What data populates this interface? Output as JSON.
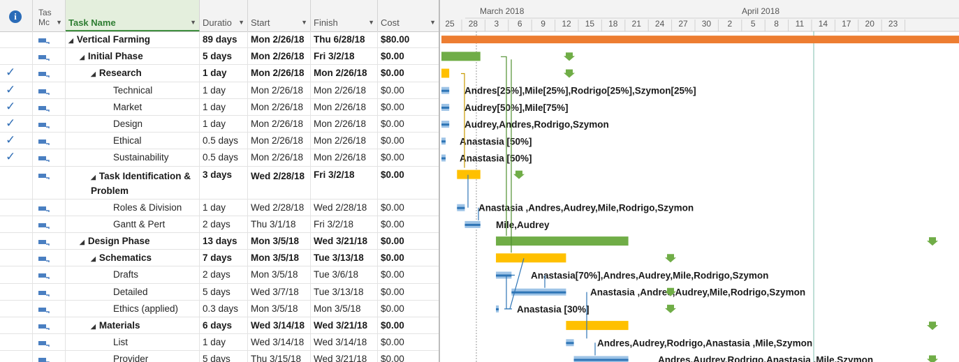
{
  "table": {
    "headers": {
      "mode_line1": "Tas",
      "mode_line2": "Mc",
      "task_name": "Task Name",
      "duration": "Duratio",
      "start": "Start",
      "finish": "Finish",
      "cost": "Cost"
    },
    "rows": [
      {
        "done": false,
        "level": 0,
        "summary": true,
        "name": "Vertical Farming",
        "duration": "89 days",
        "start": "Mon 2/26/18",
        "finish": "Thu 6/28/18",
        "cost": "$80.00"
      },
      {
        "done": false,
        "level": 1,
        "summary": true,
        "name": "Initial Phase",
        "duration": "5 days",
        "start": "Mon 2/26/18",
        "finish": "Fri 3/2/18",
        "cost": "$0.00"
      },
      {
        "done": true,
        "level": 2,
        "summary": true,
        "name": "Research",
        "duration": "1 day",
        "start": "Mon 2/26/18",
        "finish": "Mon 2/26/18",
        "cost": "$0.00"
      },
      {
        "done": true,
        "level": 3,
        "summary": false,
        "name": "Technical",
        "duration": "1 day",
        "start": "Mon 2/26/18",
        "finish": "Mon 2/26/18",
        "cost": "$0.00"
      },
      {
        "done": true,
        "level": 3,
        "summary": false,
        "name": "Market",
        "duration": "1 day",
        "start": "Mon 2/26/18",
        "finish": "Mon 2/26/18",
        "cost": "$0.00"
      },
      {
        "done": true,
        "level": 3,
        "summary": false,
        "name": "Design",
        "duration": "1 day",
        "start": "Mon 2/26/18",
        "finish": "Mon 2/26/18",
        "cost": "$0.00"
      },
      {
        "done": true,
        "level": 3,
        "summary": false,
        "name": "Ethical",
        "duration": "0.5 days",
        "start": "Mon 2/26/18",
        "finish": "Mon 2/26/18",
        "cost": "$0.00"
      },
      {
        "done": true,
        "level": 3,
        "summary": false,
        "name": "Sustainability",
        "duration": "0.5 days",
        "start": "Mon 2/26/18",
        "finish": "Mon 2/26/18",
        "cost": "$0.00"
      },
      {
        "done": false,
        "level": 2,
        "summary": true,
        "name": "Task Identification & Problem",
        "duration": "3 days",
        "start": "Wed 2/28/18",
        "finish": "Fri 3/2/18",
        "cost": "$0.00"
      },
      {
        "done": false,
        "level": 3,
        "summary": false,
        "name": "Roles & Division",
        "duration": "1 day",
        "start": "Wed 2/28/18",
        "finish": "Wed 2/28/18",
        "cost": "$0.00"
      },
      {
        "done": false,
        "level": 3,
        "summary": false,
        "name": "Gantt & Pert",
        "duration": "2 days",
        "start": "Thu 3/1/18",
        "finish": "Fri 3/2/18",
        "cost": "$0.00"
      },
      {
        "done": false,
        "level": 1,
        "summary": true,
        "name": "Design Phase",
        "duration": "13 days",
        "start": "Mon 3/5/18",
        "finish": "Wed 3/21/18",
        "cost": "$0.00"
      },
      {
        "done": false,
        "level": 2,
        "summary": true,
        "name": "Schematics",
        "duration": "7 days",
        "start": "Mon 3/5/18",
        "finish": "Tue 3/13/18",
        "cost": "$0.00"
      },
      {
        "done": false,
        "level": 3,
        "summary": false,
        "name": "Drafts",
        "duration": "2 days",
        "start": "Mon 3/5/18",
        "finish": "Tue 3/6/18",
        "cost": "$0.00"
      },
      {
        "done": false,
        "level": 3,
        "summary": false,
        "name": "Detailed",
        "duration": "5 days",
        "start": "Wed 3/7/18",
        "finish": "Tue 3/13/18",
        "cost": "$0.00"
      },
      {
        "done": false,
        "level": 3,
        "summary": false,
        "name": "Ethics (applied)",
        "duration": "0.3 days",
        "start": "Mon 3/5/18",
        "finish": "Mon 3/5/18",
        "cost": "$0.00"
      },
      {
        "done": false,
        "level": 2,
        "summary": true,
        "name": "Materials",
        "duration": "6 days",
        "start": "Wed 3/14/18",
        "finish": "Wed 3/21/18",
        "cost": "$0.00"
      },
      {
        "done": false,
        "level": 3,
        "summary": false,
        "name": "List",
        "duration": "1 day",
        "start": "Wed 3/14/18",
        "finish": "Wed 3/14/18",
        "cost": "$0.00"
      },
      {
        "done": false,
        "level": 3,
        "summary": false,
        "name": "Provider",
        "duration": "5 days",
        "start": "Thu 3/15/18",
        "finish": "Wed 3/21/18",
        "cost": "$0.00"
      }
    ]
  },
  "timescale": {
    "months": [
      "March 2018",
      "April 2018"
    ],
    "days": [
      "25",
      "28",
      "3",
      "6",
      "9",
      "12",
      "15",
      "18",
      "21",
      "24",
      "27",
      "30",
      "2",
      "5",
      "8",
      "11",
      "14",
      "17",
      "20",
      "23"
    ]
  },
  "gantt_labels": [
    "Andres[25%],Mile[25%],Rodrigo[25%],Szymon[25%]",
    "Audrey[50%],Mile[75%]",
    "Audrey,Andres,Rodrigo,Szymon",
    "Anastasia [50%]",
    "Anastasia [50%]",
    "Anastasia ,Andres,Audrey,Mile,Rodrigo,Szymon",
    "Mile,Audrey",
    "Anastasia[70%],Andres,Audrey,Mile,Rodrigo,Szymon",
    "Anastasia ,Andres,Audrey,Mile,Rodrigo,Szymon",
    "Anastasia [30%]",
    "Andres,Audrey,Rodrigo,Anastasia ,Mile,Szymon",
    "Andres,Audrey,Rodrigo,Anastasia ,Mile,Szymon"
  ],
  "colors": {
    "project_summary": "#ed7d31",
    "summary_green": "#70ad47",
    "summary_yellow": "#ffc000",
    "task_blue": "#9dc3e6",
    "link_arrow": "#2e75b6",
    "deadline_green": "#70ad47"
  }
}
